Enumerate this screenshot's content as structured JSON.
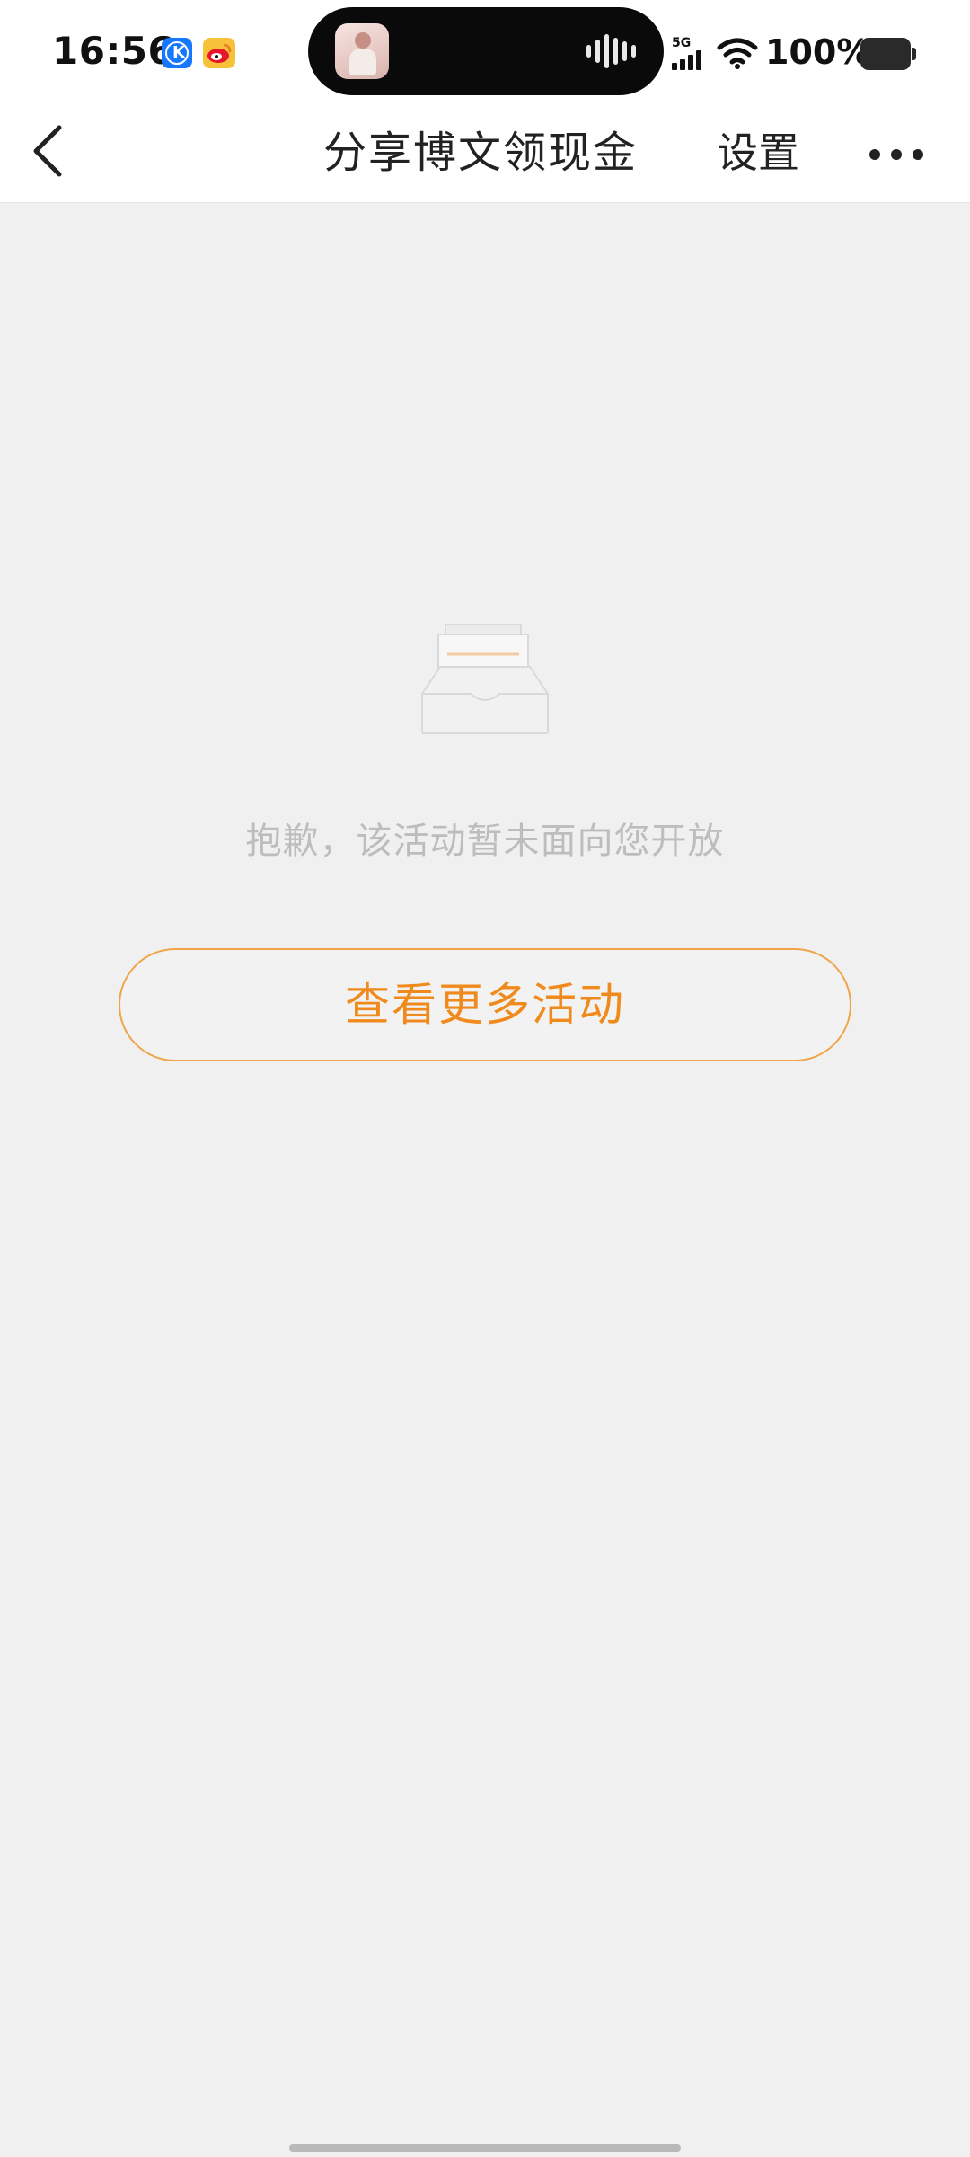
{
  "status_bar": {
    "time": "16:56",
    "network": "5G",
    "battery": "100%",
    "app_icons": [
      "k-app-icon",
      "weibo-icon"
    ],
    "island_avatar": "photo-avatar",
    "island_indicator": "audio-wave-icon"
  },
  "nav": {
    "back_icon": "chevron-left-icon",
    "title": "分享博文领现金",
    "settings_label": "设置",
    "more_icon": "more-dots-icon"
  },
  "content": {
    "empty_icon": "empty-inbox-icon",
    "empty_message": "抱歉，该活动暂未面向您开放",
    "more_button_label": "查看更多活动"
  },
  "colors": {
    "accent": "#f08a1c",
    "button_border": "#f0a54a",
    "background": "#f0f0f0",
    "muted_text": "#bdbdbd"
  }
}
